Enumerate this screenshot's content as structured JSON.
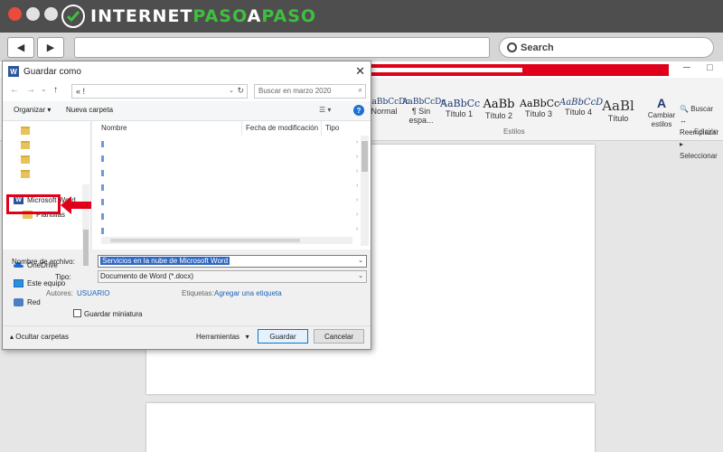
{
  "site": {
    "brand_internet": "INTERNET",
    "brand_paso1": "PASO",
    "brand_a": "A",
    "brand_paso2": "PASO",
    "search_label": "Search",
    "colors": {
      "green": "#3fbf3f",
      "red": "#e0001a"
    }
  },
  "word": {
    "styles": [
      {
        "preview": "AaBbCcDc",
        "name": "Normal"
      },
      {
        "preview": "AaBbCcDc",
        "name": "¶ Sin espa..."
      },
      {
        "preview": "AaBbCc",
        "name": "Título 1"
      },
      {
        "preview": "AaBb",
        "name": "Título 2"
      },
      {
        "preview": "AaBbCc",
        "name": "Título 3"
      },
      {
        "preview": "AaBbCcD",
        "name": "Título 4"
      },
      {
        "preview": "AaBl",
        "name": "Título"
      }
    ],
    "change_styles": "Cambiar estilos",
    "group_styles": "Estilos",
    "group_edit": "Edición",
    "find": "Buscar",
    "replace": "Reemplazar",
    "select": "Seleccionar"
  },
  "dialog": {
    "title": "Guardar como",
    "address": "« !",
    "search_placeholder": "Buscar en marzo 2020",
    "organize": "Organizar",
    "new_folder": "Nueva carpeta",
    "columns": {
      "name": "Nombre",
      "date": "Fecha de modificación",
      "type": "Tipo"
    },
    "nav": {
      "microsoft_word": "Microsoft Word",
      "plantillas": "Plantillas",
      "onedrive": "OneDrive",
      "este_equipo": "Este equipo",
      "red": "Red"
    },
    "filename_label": "Nombre de archivo:",
    "filename_value": "Servicios en la nube de Microsoft Word",
    "type_label": "Tipo:",
    "type_value": "Documento de Word (*.docx)",
    "authors_label": "Autores:",
    "authors_value": "USUARIO",
    "tags_label": "Etiquetas:",
    "tags_value": "Agregar una etiqueta",
    "thumbnail_label": "Guardar miniatura",
    "hide_folders": "Ocultar carpetas",
    "tools": "Herramientas",
    "save": "Guardar",
    "cancel": "Cancelar"
  }
}
